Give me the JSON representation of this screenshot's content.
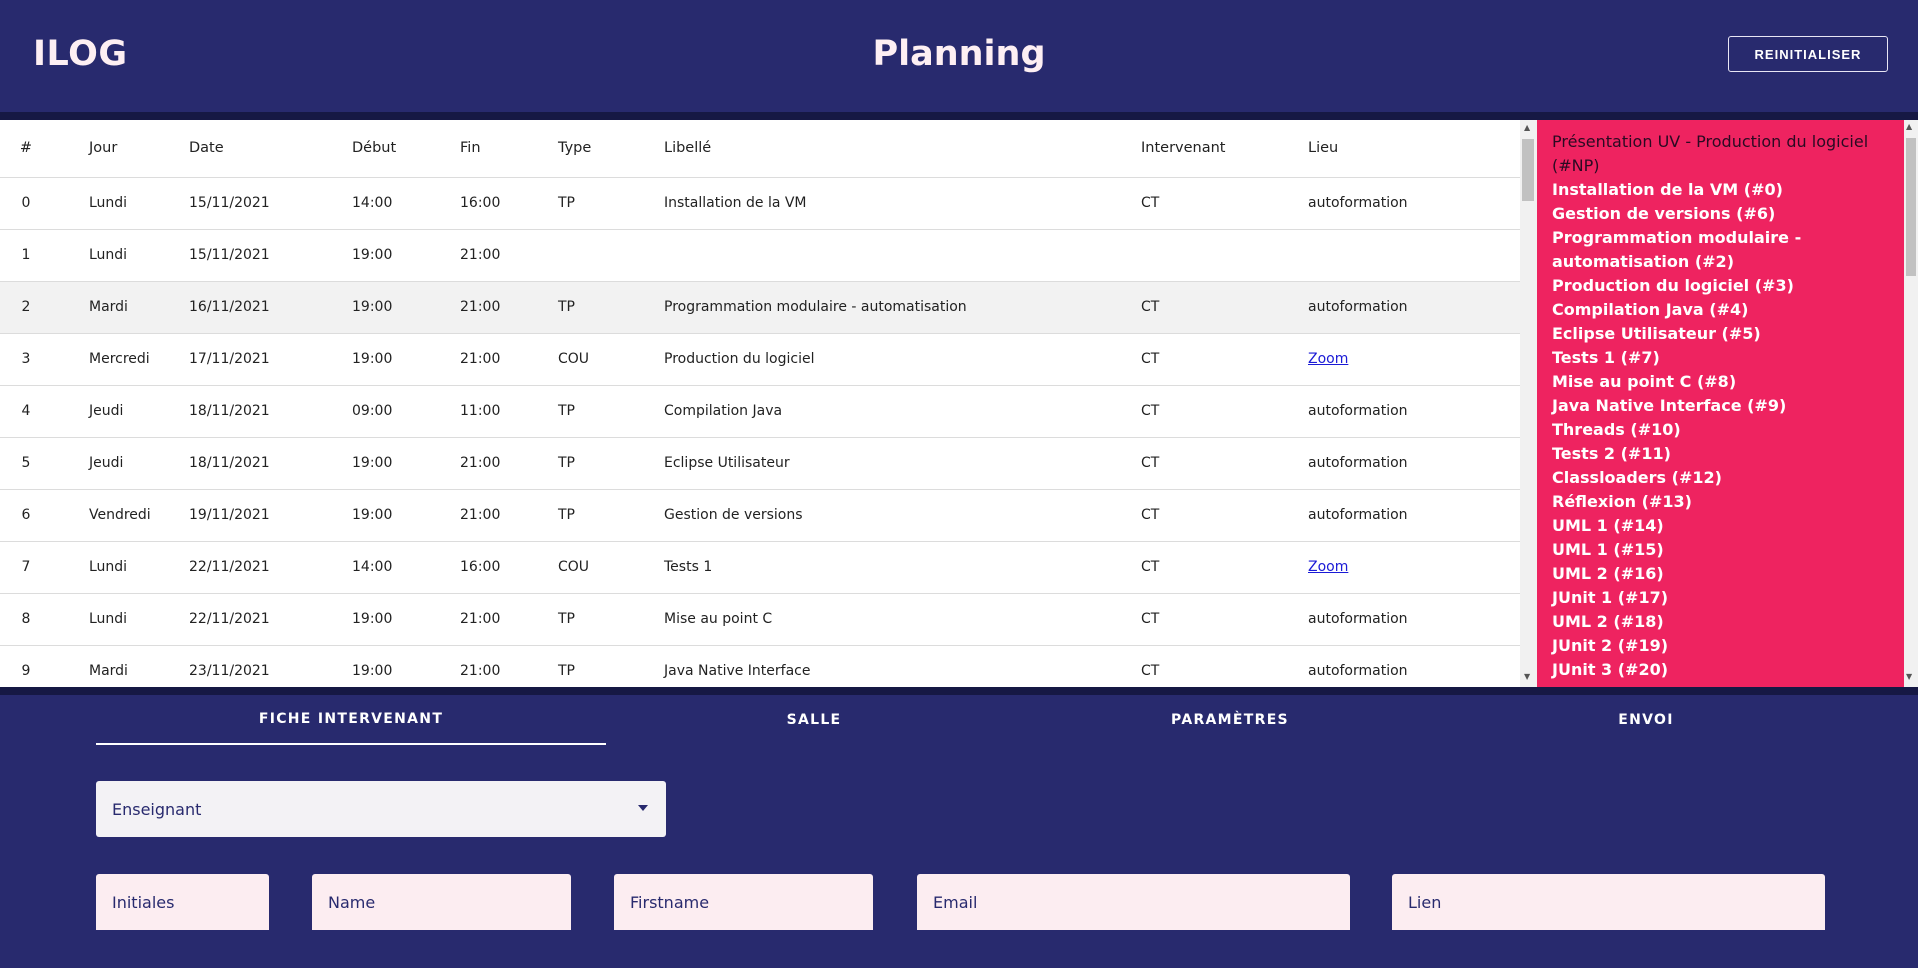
{
  "header": {
    "logo": "ILOG",
    "title": "Planning",
    "reset_label": "REINITIALISER"
  },
  "table": {
    "columns": [
      "#",
      "Jour",
      "Date",
      "Début",
      "Fin",
      "Type",
      "Libellé",
      "Intervenant",
      "Lieu"
    ],
    "rows": [
      {
        "idx": "0",
        "jour": "Lundi",
        "date": "15/11/2021",
        "debut": "14:00",
        "fin": "16:00",
        "type": "TP",
        "libelle": "Installation de la VM",
        "intervenant": "CT",
        "lieu": "autoformation"
      },
      {
        "idx": "1",
        "jour": "Lundi",
        "date": "15/11/2021",
        "debut": "19:00",
        "fin": "21:00",
        "type": "",
        "libelle": "",
        "intervenant": "",
        "lieu": ""
      },
      {
        "idx": "2",
        "jour": "Mardi",
        "date": "16/11/2021",
        "debut": "19:00",
        "fin": "21:00",
        "type": "TP",
        "libelle": "Programmation modulaire - automatisation",
        "intervenant": "CT",
        "lieu": "autoformation"
      },
      {
        "idx": "3",
        "jour": "Mercredi",
        "date": "17/11/2021",
        "debut": "19:00",
        "fin": "21:00",
        "type": "COU",
        "libelle": "Production du logiciel",
        "intervenant": "CT",
        "lieu": "Zoom"
      },
      {
        "idx": "4",
        "jour": "Jeudi",
        "date": "18/11/2021",
        "debut": "09:00",
        "fin": "11:00",
        "type": "TP",
        "libelle": "Compilation Java",
        "intervenant": "CT",
        "lieu": "autoformation"
      },
      {
        "idx": "5",
        "jour": "Jeudi",
        "date": "18/11/2021",
        "debut": "19:00",
        "fin": "21:00",
        "type": "TP",
        "libelle": "Eclipse Utilisateur",
        "intervenant": "CT",
        "lieu": "autoformation"
      },
      {
        "idx": "6",
        "jour": "Vendredi",
        "date": "19/11/2021",
        "debut": "19:00",
        "fin": "21:00",
        "type": "TP",
        "libelle": "Gestion de versions",
        "intervenant": "CT",
        "lieu": "autoformation"
      },
      {
        "idx": "7",
        "jour": "Lundi",
        "date": "22/11/2021",
        "debut": "14:00",
        "fin": "16:00",
        "type": "COU",
        "libelle": "Tests 1",
        "intervenant": "CT",
        "lieu": "Zoom"
      },
      {
        "idx": "8",
        "jour": "Lundi",
        "date": "22/11/2021",
        "debut": "19:00",
        "fin": "21:00",
        "type": "TP",
        "libelle": "Mise au point C",
        "intervenant": "CT",
        "lieu": "autoformation"
      },
      {
        "idx": "9",
        "jour": "Mardi",
        "date": "23/11/2021",
        "debut": "19:00",
        "fin": "21:00",
        "type": "TP",
        "libelle": "Java Native Interface",
        "intervenant": "CT",
        "lieu": "autoformation"
      }
    ]
  },
  "side_list": [
    "Présentation UV - Production du logiciel (#NP)",
    "Installation de la VM (#0)",
    "Gestion de versions (#6)",
    "Programmation modulaire - automatisation (#2)",
    "Production du logiciel (#3)",
    "Compilation Java (#4)",
    "Eclipse Utilisateur (#5)",
    "Tests 1 (#7)",
    "Mise au point C (#8)",
    "Java Native Interface (#9)",
    "Threads (#10)",
    "Tests 2 (#11)",
    "Classloaders (#12)",
    "Réflexion (#13)",
    "UML 1 (#14)",
    "UML 1 (#15)",
    "UML 2 (#16)",
    "JUnit 1 (#17)",
    "UML 2 (#18)",
    "JUnit 2 (#19)",
    "JUnit 3 (#20)"
  ],
  "tabs": [
    "FICHE INTERVENANT",
    "SALLE",
    "PARAMÈTRES",
    "ENVOI"
  ],
  "form": {
    "role_value": "Enseignant",
    "initiales_placeholder": "Initiales",
    "name_placeholder": "Name",
    "firstname_placeholder": "Firstname",
    "email_placeholder": "Email",
    "lien_placeholder": "Lien"
  },
  "colors": {
    "background": "#282a6e",
    "side_panel": "#ee2360",
    "link": "#1a1ad6"
  }
}
